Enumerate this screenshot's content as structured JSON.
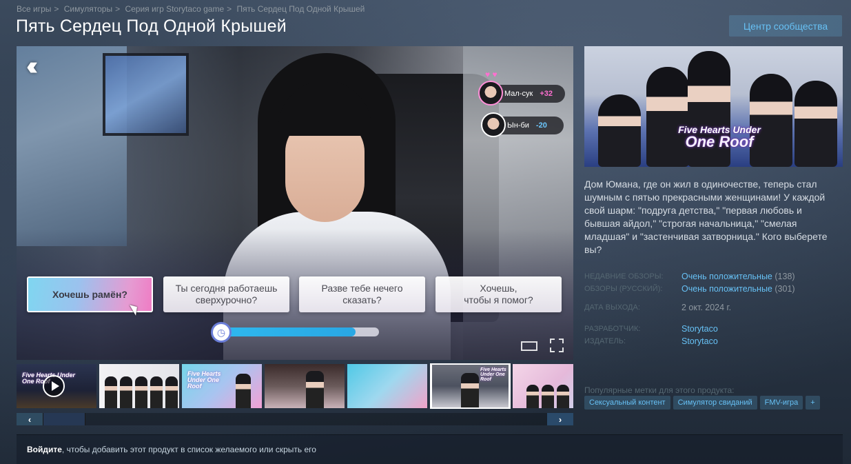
{
  "breadcrumb": [
    "Все игры",
    "Симуляторы",
    "Серия игр Storytaco game",
    "Пять Сердец Под Одной Крышей"
  ],
  "breadcrumb_separator": ">",
  "title": "Пять Сердец Под Одной Крышей",
  "community_button": "Центр сообщества",
  "media": {
    "characters": [
      {
        "name": "Мал-сук",
        "delta": "+32"
      },
      {
        "name": "Ын-би",
        "delta": "-20"
      }
    ],
    "choices": [
      {
        "text": "Хочешь рамён?",
        "selected": true
      },
      {
        "text": "Ты сегодня работаешь\nсверхурочно?",
        "selected": false
      },
      {
        "text": "Разве тебе нечего\nсказать?",
        "selected": false
      },
      {
        "text": "Хочешь,\nчтобы я помог?",
        "selected": false
      }
    ],
    "timer_progress": 0.85
  },
  "thumbnails": [
    {
      "type": "video",
      "logo": "Five Hearts Under One Roof"
    },
    {
      "type": "image"
    },
    {
      "type": "image",
      "logo": "Five Hearts Under One Roof"
    },
    {
      "type": "image"
    },
    {
      "type": "image"
    },
    {
      "type": "image",
      "selected": true,
      "logo": "Five Hearts Under One Roof"
    },
    {
      "type": "image"
    }
  ],
  "slider": {
    "left": "‹",
    "right": "›"
  },
  "capsule_logo": {
    "line1": "Five Hearts Under",
    "line2": "One Roof"
  },
  "description": "Дом Юмана, где он жил в одиночестве, теперь стал шумным с пятью прекрасными женщинами! У каждой свой шарм: \"подруга детства,\" \"первая любовь и бывшая айдол,\" \"строгая начальница,\" \"смелая младшая\" и \"застенчивая затворница.\" Кого выберете вы?",
  "reviews": {
    "recent_label": "НЕДАВНИЕ ОБЗОРЫ:",
    "recent_value": "Очень положительные",
    "recent_count": "(138)",
    "all_label": "ОБЗОРЫ (РУССКИЙ):",
    "all_value": "Очень положительные",
    "all_count": "(301)"
  },
  "release": {
    "label": "ДАТА ВЫХОДА:",
    "value": "2 окт. 2024 г."
  },
  "developer": {
    "label": "РАЗРАБОТЧИК:",
    "value": "Storytaco"
  },
  "publisher": {
    "label": "ИЗДАТЕЛЬ:",
    "value": "Storytaco"
  },
  "tags_label": "Популярные метки для этого продукта:",
  "tags": [
    "Сексуальный контент",
    "Симулятор свиданий",
    "FMV-игра",
    "+"
  ],
  "login": {
    "link": "Войдите",
    "rest": ", чтобы добавить этот продукт в список желаемого или скрыть его"
  },
  "colors": {
    "accent": "#67c1f5",
    "title": "#ffffff",
    "label": "#556772"
  }
}
